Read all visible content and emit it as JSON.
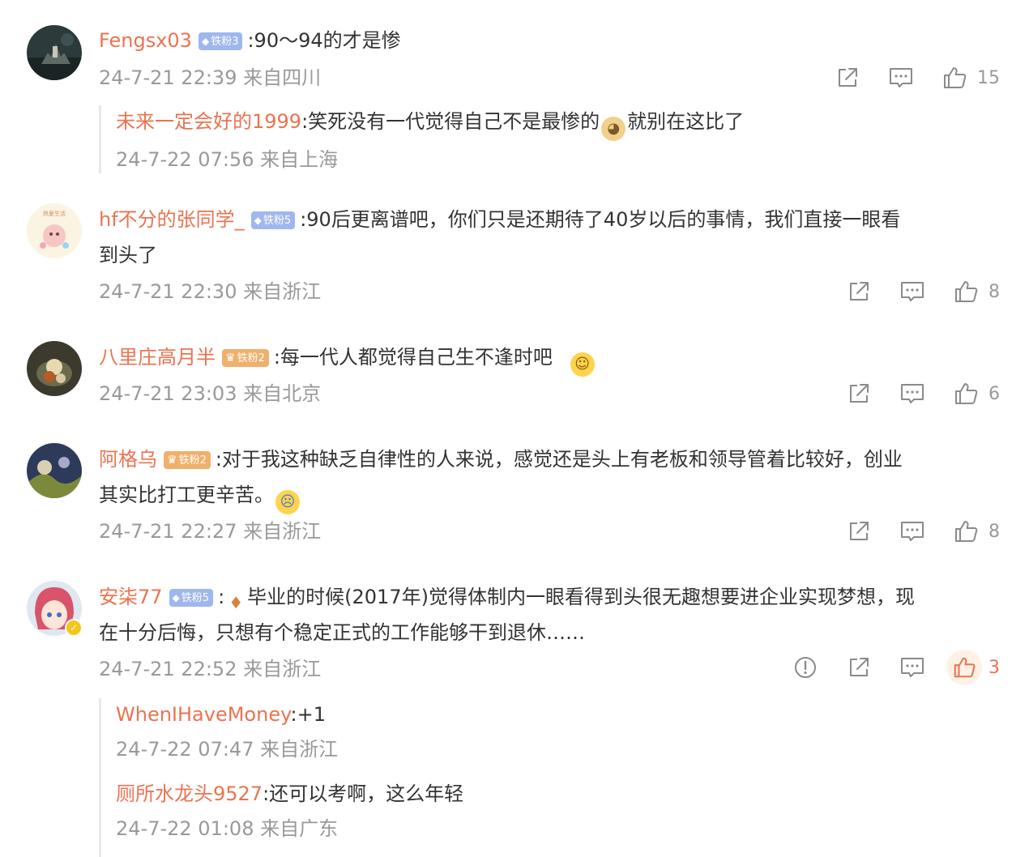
{
  "comments": [
    {
      "user": "Fengsx03",
      "badge": "铁粉3",
      "text": ":90～94的才是惨",
      "time": "24-7-21 22:39 来自四川",
      "likes": "15",
      "replies": [
        {
          "user": "未来一定会好的1999",
          "text_before": ":笑死没有一代觉得自己不是最惨的",
          "text_after": "就别在这比了",
          "time": "24-7-22 07:56 来自上海"
        }
      ]
    },
    {
      "user": "hf不分的张同学_",
      "badge": "铁粉5",
      "text_line1": ":90后更离谱吧，你们只是还期待了40岁以后的事情，我们直接一眼看",
      "text_line2": "到头了",
      "avatar_text": "热爱生活",
      "time": "24-7-21 22:30 来自浙江",
      "likes": "8"
    },
    {
      "user": "八里庄高月半",
      "badge": "铁粉2",
      "text": ":每一代人都觉得自己生不逢时吧",
      "time": "24-7-21 23:03 来自北京",
      "likes": "6"
    },
    {
      "user": "阿格乌",
      "badge": "铁粉2",
      "text_line1": ":对于我这种缺乏自律性的人来说，感觉还是头上有老板和领导管着比较好，创业",
      "text_line2": "其实比打工更辛苦。",
      "time": "24-7-21 22:27 来自浙江",
      "likes": "8"
    },
    {
      "user": "安柒77",
      "badge": "铁粉5",
      "text_line1": "毕业的时候(2017年)觉得体制内一眼看得到头很无趣想要进企业实现梦想，现",
      "text_line2": "在十分后悔，只想有个稳定正式的工作能够干到退休……",
      "time": "24-7-21 22:52 来自浙江",
      "likes": "3",
      "replies": [
        {
          "user": "WhenIHaveMoney",
          "text": ":+1",
          "time": "24-7-22 07:47 来自浙江"
        },
        {
          "user": "厕所水龙头9527",
          "text": ":还可以考啊，这么年轻",
          "time": "24-7-22 01:08 来自广东"
        }
      ]
    }
  ],
  "colors": {
    "name": "#eb7350",
    "meta": "#999999",
    "text": "#333333",
    "badge_blue": "#9fb7ee",
    "badge_gold": "#f0b06c"
  }
}
